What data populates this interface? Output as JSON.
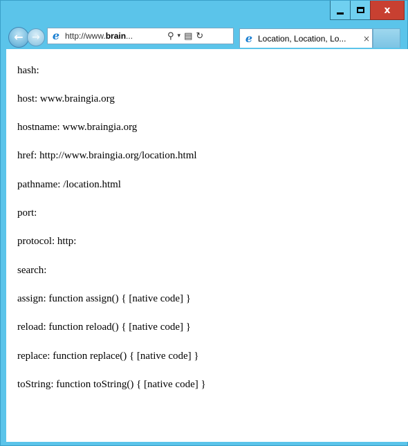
{
  "titlebar": {
    "minimize_icon": "minimize-icon",
    "maximize_icon": "maximize-icon",
    "close_glyph": "x",
    "close_color": "#c84031"
  },
  "nav": {
    "back_glyph": "←",
    "forward_glyph": "→",
    "address": {
      "prefix": "http://www.",
      "bold": "brain",
      "suffix": "...",
      "search_glyph": "⚲",
      "dropdown_glyph": "▾",
      "compat_glyph": "▤",
      "refresh_glyph": "↻"
    },
    "tab": {
      "title": "Location, Location, Lo...",
      "close_glyph": "×"
    }
  },
  "content": {
    "lines": [
      "hash:",
      "host: www.braingia.org",
      "hostname: www.braingia.org",
      "href: http://www.braingia.org/location.html",
      "pathname: /location.html",
      "port:",
      "protocol: http:",
      "search:",
      "assign: function assign() { [native code] }",
      "reload: function reload() { [native code] }",
      "replace: function replace() { [native code] }",
      "toString: function toString() { [native code] }"
    ]
  },
  "colors": {
    "frame": "#5bc4ea",
    "close_button": "#c84031",
    "ie_icon": "#1a7fd1"
  }
}
